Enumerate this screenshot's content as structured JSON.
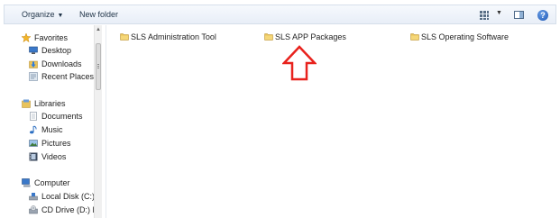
{
  "toolbar": {
    "organize_label": "Organize",
    "new_folder_label": "New folder",
    "icons": [
      "views-icon",
      "preview-pane-icon",
      "help-icon"
    ],
    "help_glyph": "?"
  },
  "nav": {
    "favorites": {
      "label": "Favorites",
      "items": [
        {
          "label": "Desktop",
          "icon": "desktop-icon"
        },
        {
          "label": "Downloads",
          "icon": "downloads-icon"
        },
        {
          "label": "Recent Places",
          "icon": "recent-places-icon"
        }
      ]
    },
    "libraries": {
      "label": "Libraries",
      "items": [
        {
          "label": "Documents",
          "icon": "documents-icon"
        },
        {
          "label": "Music",
          "icon": "music-icon"
        },
        {
          "label": "Pictures",
          "icon": "pictures-icon"
        },
        {
          "label": "Videos",
          "icon": "videos-icon"
        }
      ]
    },
    "computer": {
      "label": "Computer",
      "items": [
        {
          "label": "Local Disk (C:)",
          "icon": "local-disk-icon"
        },
        {
          "label": "CD Drive (D:) Di",
          "icon": "cd-drive-icon"
        }
      ]
    }
  },
  "files": [
    {
      "name": "SLS Administration Tool",
      "icon": "folder-icon"
    },
    {
      "name": "SLS APP Packages",
      "icon": "folder-icon"
    },
    {
      "name": "SLS Operating Software",
      "icon": "folder-icon"
    }
  ],
  "annotation": {
    "icon": "up-arrow-icon",
    "color": "#e8221d"
  },
  "colors": {
    "folder": "#e9c35a",
    "toolbar": "#eef3fa",
    "accent": "#1d55b3"
  }
}
